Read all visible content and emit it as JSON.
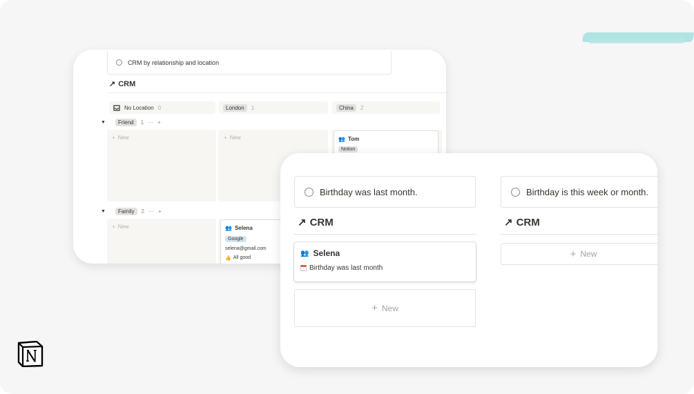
{
  "back_card": {
    "view_label": "CRM by relationship and location",
    "title": "CRM",
    "columns": [
      {
        "label": "No Location",
        "count": "0"
      },
      {
        "label": "London",
        "count": "1"
      },
      {
        "label": "China",
        "count": "2"
      }
    ],
    "groups": [
      {
        "label": "Friend",
        "count": "1"
      },
      {
        "label": "Family",
        "count": "2"
      }
    ],
    "new_label": "New",
    "more_glyph": "···",
    "add_glyph": "+",
    "cards": {
      "tom": {
        "name": "Tom",
        "tag": "Notion"
      },
      "selena": {
        "name": "Selena",
        "tag": "Google",
        "email": "selena@gmail.com",
        "status": "All good"
      }
    }
  },
  "front_card": {
    "views": [
      {
        "label": "Birthday was last month."
      },
      {
        "label": "Birthday is this week or month."
      }
    ],
    "title": "CRM",
    "new_label": "New",
    "card": {
      "name": "Selena",
      "line": "Birthday was last month"
    }
  },
  "icons": {
    "arrow": "north-east-arrow-icon",
    "view": "circle-icon",
    "person": "people-icon",
    "calendar": "calendar-icon",
    "home": "inbox-icon",
    "thumbs": "thumbs-up-icon",
    "logo": "notion-logo"
  },
  "colors": {
    "background": "#f6f6f6",
    "accent_brush": "#a8e1e1",
    "text": "#37352f",
    "tag_default": "#e3e2e0",
    "tag_blue": "#d3e5ef"
  }
}
